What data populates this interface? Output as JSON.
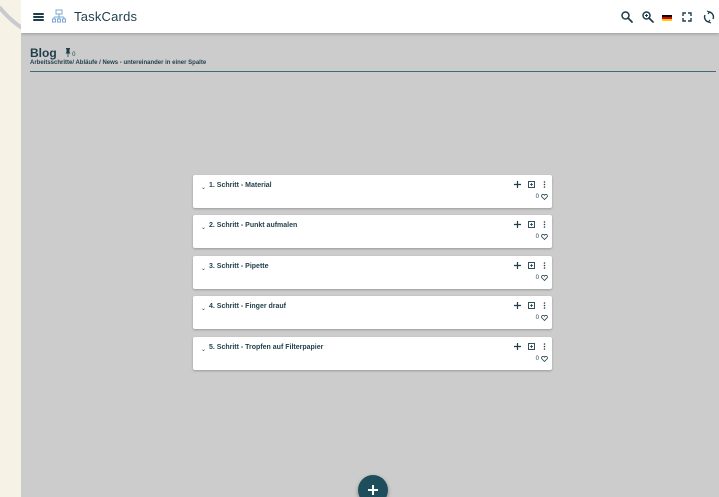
{
  "app": {
    "title": "TaskCards"
  },
  "toolbar": {
    "icons": [
      "menu-icon",
      "taskcards-logo-icon",
      "search-icon",
      "zoom-in-icon",
      "german-flag-icon",
      "fullscreen-icon",
      "refresh-icon"
    ],
    "language": "de"
  },
  "board": {
    "title": "Blog",
    "pin_count": "0",
    "description": "Arbeitsschritte/ Abläufe / News - untereinander in einer Spalte"
  },
  "cards": [
    {
      "title": "1. Schritt - Material",
      "likes": "0"
    },
    {
      "title": "2. Schritt - Punkt aufmalen",
      "likes": "0"
    },
    {
      "title": "3. Schritt - Pipette",
      "likes": "0"
    },
    {
      "title": "4. Schritt - Finger drauf",
      "likes": "0"
    },
    {
      "title": "5. Schritt - Tropfen auf Filterpapier",
      "likes": "0"
    }
  ],
  "colors": {
    "primary": "#1f3e4a",
    "canvas": "#cccccc",
    "fab": "#1e4e5c"
  }
}
